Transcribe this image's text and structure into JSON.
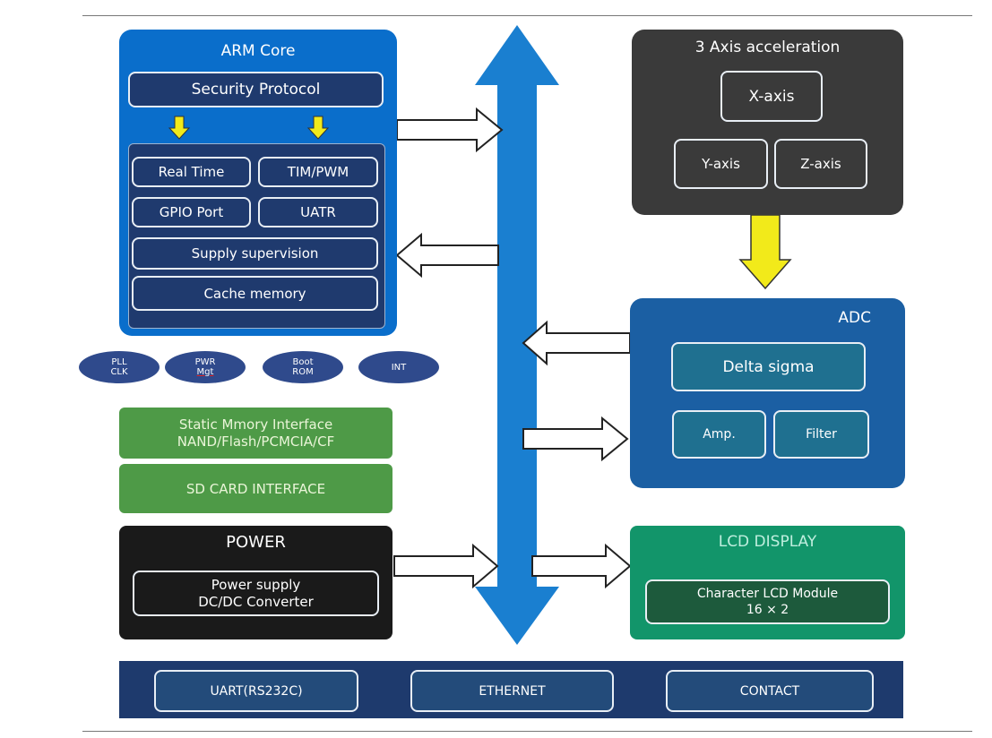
{
  "colors": {
    "arm_core": "#0a6ecb",
    "navy": "#1f3a6e",
    "accel": "#3a3a3a",
    "adc": "#1b5fa3",
    "adc_inner": "#1f7090",
    "lcd": "#12956a",
    "lcd_inner": "#1d5a3c",
    "power": "#1a1a1a",
    "memory": "#4e9a47",
    "bus": "#1a7fd0",
    "yellow": "#f2ea1a",
    "bottom_bar": "#1e3a6d"
  },
  "arm_core": {
    "title": "ARM Core",
    "security": "Security Protocol",
    "real_time": "Real Time",
    "tim_pwm": "TIM/PWM",
    "gpio": "GPIO Port",
    "uatr": "UATR",
    "supply": "Supply supervision",
    "cache": "Cache memory"
  },
  "ellipses": [
    {
      "line1": "PLL",
      "line2": "CLK"
    },
    {
      "line1": "PWR",
      "line2": "Mgt"
    },
    {
      "line1": "Boot",
      "line2": "ROM"
    },
    {
      "line1": "INT",
      "line2": ""
    }
  ],
  "memory": {
    "line1": "Static Mmory Interface",
    "line2": "NAND/Flash/PCMCIA/CF"
  },
  "sd_card": "SD CARD INTERFACE",
  "power": {
    "title": "POWER",
    "line1": "Power supply",
    "line2": "DC/DC Converter"
  },
  "accel": {
    "title": "3 Axis acceleration",
    "x": "X-axis",
    "y": "Y-axis",
    "z": "Z-axis"
  },
  "adc": {
    "title": "ADC",
    "delta": "Delta sigma",
    "amp": "Amp.",
    "filter": "Filter"
  },
  "lcd": {
    "title": "LCD DISPLAY",
    "line1": "Character LCD Module",
    "line2": "16 × 2"
  },
  "bottom": {
    "uart": "UART(RS232C)",
    "ethernet": "ETHERNET",
    "contact": "CONTACT"
  }
}
